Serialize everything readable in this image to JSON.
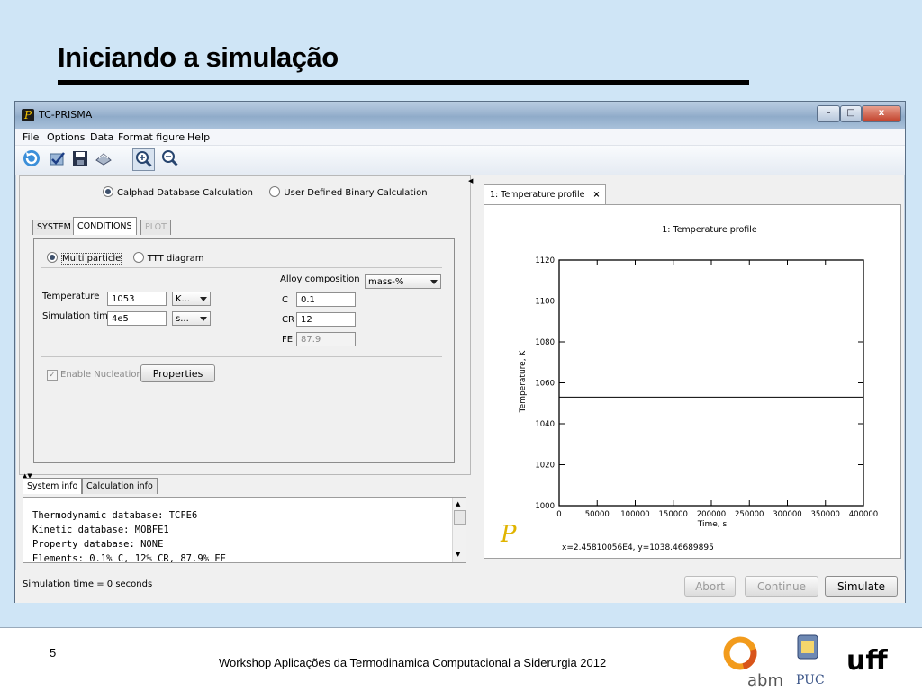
{
  "slide": {
    "title": "Iniciando a simulação",
    "page_number": "5",
    "footer": "Workshop Aplicações da Termodinamica Computacional a Siderurgia 2012",
    "logos": [
      "abm",
      "PUC",
      "uff"
    ]
  },
  "window": {
    "title": "TC-PRISMA",
    "app_icon": "P",
    "controls": {
      "minimize": "–",
      "maximize": "□",
      "close": "x"
    }
  },
  "menu": [
    "File",
    "Options",
    "Data",
    "Format figure",
    "Help"
  ],
  "toolbar": {
    "icons": [
      "refresh-icon",
      "check-icon",
      "save-icon",
      "print-icon",
      "zoom-in-icon",
      "zoom-out-icon"
    ]
  },
  "calc_mode": {
    "options": [
      "Calphad Database Calculation",
      "User Defined Binary Calculation"
    ],
    "selected": "Calphad Database Calculation"
  },
  "tabs": [
    "SYSTEM",
    "CONDITIONS",
    "PLOT"
  ],
  "active_tab": "CONDITIONS",
  "conditions": {
    "particle_options": [
      "Multi particle",
      "TTT diagram"
    ],
    "particle_selected": "Multi particle",
    "temperature_label": "Temperature",
    "temperature_value": "1053",
    "temperature_unit": "K...",
    "simtime_label": "Simulation time",
    "simtime_value": "4e5",
    "simtime_unit": "s...",
    "alloy_label": "Alloy composition",
    "alloy_unit": "mass-%",
    "composition": [
      {
        "element": "C",
        "value": "0.1",
        "disabled": false
      },
      {
        "element": "CR",
        "value": "12",
        "disabled": false
      },
      {
        "element": "FE",
        "value": "87.9",
        "disabled": true
      }
    ],
    "nucleation_label": "Enable Nucleation",
    "nucleation_checked": true,
    "properties_button": "Properties"
  },
  "info": {
    "tabs": [
      "System info",
      "Calculation info"
    ],
    "active": "System info",
    "lines": [
      "Thermodynamic database: TCFE6",
      "Kinetic database: MOBFE1",
      "Property database: NONE",
      "Elements: 0.1% C, 12% CR, 87.9% FE"
    ]
  },
  "status": {
    "text": "Simulation time = 0 seconds",
    "buttons": [
      "Abort",
      "Continue",
      "Simulate"
    ]
  },
  "plot": {
    "tab_label": "1: Temperature profile",
    "tab_close": "×",
    "cursor_readout": "x=2.45810056E4, y=1038.46689895",
    "logo": "P"
  },
  "chart_data": {
    "type": "line",
    "title": "1: Temperature profile",
    "xlabel": "Time, s",
    "ylabel": "Temperature, K",
    "xlim": [
      0,
      400000
    ],
    "ylim": [
      1000,
      1120
    ],
    "xticks": [
      0,
      50000,
      100000,
      150000,
      200000,
      250000,
      300000,
      350000,
      400000
    ],
    "yticks": [
      1000,
      1020,
      1040,
      1060,
      1080,
      1100,
      1120
    ],
    "grid": false,
    "series": [
      {
        "x": [
          0,
          400000
        ],
        "y": [
          1053,
          1053
        ]
      }
    ]
  }
}
